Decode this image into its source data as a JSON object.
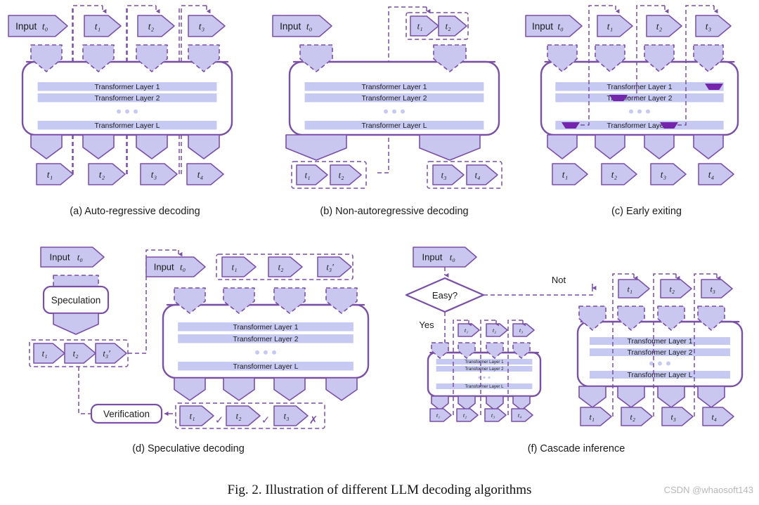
{
  "figure": {
    "caption": "Fig. 2.  Illustration of different LLM decoding algorithms",
    "watermark": "CSDN @whaosoft143"
  },
  "colors": {
    "stroke": "#7a4fa6",
    "fill_token": "#c9c6ef",
    "fill_layer": "#c6c9f2",
    "fill_white": "#ffffff",
    "exit_marker": "#7326ab",
    "text": "#1b1b1b",
    "watermark": "#b8b8b8"
  },
  "labels": {
    "input": "Input",
    "input_token": "t₀",
    "transformer_layer_1": "Transformer Layer 1",
    "transformer_layer_2": "Transformer Layer 2",
    "transformer_layer_L": "Transformer Layer L",
    "speculation": "Speculation",
    "verification": "Verification",
    "easy": "Easy?",
    "yes": "Yes",
    "not": "Not",
    "check": "✓",
    "cross": "✗"
  },
  "panels": [
    {
      "id": "a",
      "caption": "(a) Auto-regressive decoding",
      "input_label": "Input",
      "input_token": "t₀",
      "top_tokens": [
        "t₁",
        "t₂",
        "t₃"
      ],
      "bottom_tokens": [
        "t₁",
        "t₂",
        "t₃",
        "t₄"
      ],
      "layers": [
        "Transformer Layer 1",
        "Transformer Layer 2",
        "Transformer Layer L"
      ],
      "n_streams": 4,
      "grouped_top": false,
      "grouped_bottom": false,
      "early_exit_markers": []
    },
    {
      "id": "b",
      "caption": "(b) Non-autoregressive decoding",
      "input_label": "Input",
      "input_token": "t₀",
      "top_tokens": [
        "t₁",
        "t₂"
      ],
      "bottom_tokens": [
        "t₁",
        "t₂",
        "t₃",
        "t₄"
      ],
      "layers": [
        "Transformer Layer 1",
        "Transformer Layer 2",
        "Transformer Layer L"
      ],
      "n_streams": 2,
      "grouped_top": true,
      "grouped_bottom": true,
      "early_exit_markers": []
    },
    {
      "id": "c",
      "caption": "(c) Early exiting",
      "input_label": "Input",
      "input_token": "t₀",
      "top_tokens": [
        "t₁",
        "t₂",
        "t₃"
      ],
      "bottom_tokens": [
        "t₁",
        "t₂",
        "t₃",
        "t₄"
      ],
      "layers": [
        "Transformer Layer 1",
        "Transformer Layer 2",
        "Transformer Layer L"
      ],
      "n_streams": 4,
      "grouped_top": false,
      "grouped_bottom": false,
      "early_exit_markers": [
        "layer-L-stream-1",
        "layer-2-stream-2",
        "layer-L-stream-3",
        "layer-1-stream-4"
      ]
    },
    {
      "id": "d",
      "caption": "(d) Speculative decoding",
      "input_label": "Input",
      "input_token": "t₀",
      "draft_tokens": [
        "t₁",
        "t₂",
        "t₃′"
      ],
      "top_tokens": [
        "t₁",
        "t₂",
        "t₃′"
      ],
      "bottom_tokens": [
        "t₁",
        "t₂",
        "t₃"
      ],
      "bottom_marks": [
        "✓",
        "✓",
        "✗"
      ],
      "layers": [
        "Transformer Layer 1",
        "Transformer Layer 2",
        "Transformer Layer L"
      ],
      "speculation_label": "Speculation",
      "verification_label": "Verification",
      "n_streams": 4
    },
    {
      "id": "f",
      "caption": "(f) Cascade inference",
      "input_label": "Input",
      "input_token": "t₀",
      "decision_label": "Easy?",
      "branch_yes": "Yes",
      "branch_no": "Not",
      "small_model": {
        "top_tokens": [
          "t₁",
          "t₂",
          "t₃"
        ],
        "bottom_tokens": [
          "t₁",
          "t₂",
          "t₃",
          "t₄"
        ],
        "layers": [
          "Transformer Layer 1",
          "Transformer Layer 2",
          "Transformer Layer L"
        ]
      },
      "large_model": {
        "top_tokens": [
          "t₁",
          "t₂",
          "t₃"
        ],
        "bottom_tokens": [
          "t₁",
          "t₂",
          "t₃",
          "t₄"
        ],
        "layers": [
          "Transformer Layer 1",
          "Transformer Layer 2",
          "Transformer Layer L"
        ]
      }
    }
  ]
}
